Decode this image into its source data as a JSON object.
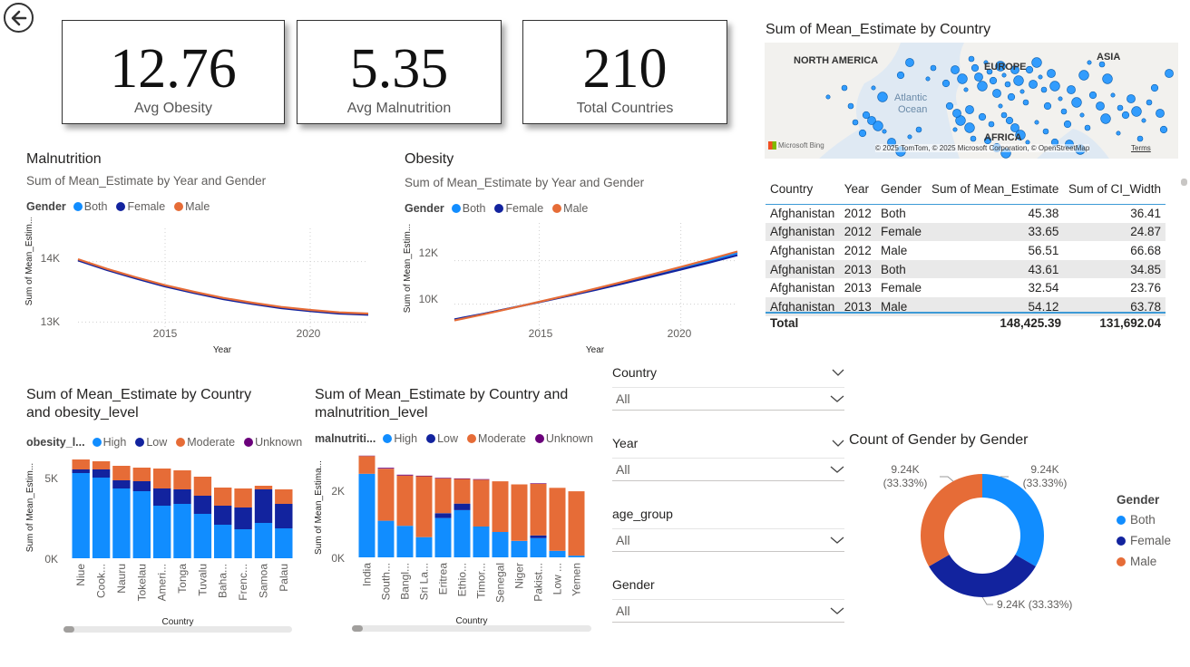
{
  "colors": {
    "both": "#118dff",
    "female": "#12239e",
    "male": "#e66c37",
    "unknown": "#6b007b",
    "high": "#118dff",
    "low": "#12239e",
    "moderate": "#e66c37"
  },
  "cards": [
    {
      "value": "12.76",
      "label": "Avg Obesity"
    },
    {
      "value": "5.35",
      "label": "Avg Malnutrition"
    },
    {
      "value": "210",
      "label": "Total Countries"
    }
  ],
  "map": {
    "title": "Sum of Mean_Estimate by Country",
    "labels": {
      "north_america": "NORTH AMERICA",
      "europe": "EUROPE",
      "asia": "ASIA",
      "atlantic": "Atlantic",
      "ocean": "Ocean",
      "africa": "AFRICA"
    },
    "bing": "Microsoft Bing",
    "copyright": "© 2025 TomTom, © 2025 Microsoft Corporation, © OpenStreetMap",
    "terms": "Terms"
  },
  "table": {
    "headers": [
      "Country",
      "Year",
      "Gender",
      "Sum of Mean_Estimate",
      "Sum of CI_Width"
    ],
    "rows": [
      [
        "Afghanistan",
        "2012",
        "Both",
        "45.38",
        "36.41"
      ],
      [
        "Afghanistan",
        "2012",
        "Female",
        "33.65",
        "24.87"
      ],
      [
        "Afghanistan",
        "2012",
        "Male",
        "56.51",
        "66.68"
      ],
      [
        "Afghanistan",
        "2013",
        "Both",
        "43.61",
        "34.85"
      ],
      [
        "Afghanistan",
        "2013",
        "Female",
        "32.54",
        "23.76"
      ],
      [
        "Afghanistan",
        "2013",
        "Male",
        "54.12",
        "63.78"
      ]
    ],
    "total": [
      "Total",
      "",
      "",
      "148,425.39",
      "131,692.04"
    ]
  },
  "malnutrition_line": {
    "title": "Malnutrition",
    "subtitle": "Sum of Mean_Estimate by Year and Gender",
    "legend_title": "Gender",
    "legend": [
      "Both",
      "Female",
      "Male"
    ],
    "ylabel": "Sum of Mean_Estim...",
    "xlabel": "Year",
    "yticks": [
      "14K",
      "13K"
    ],
    "xticks": [
      "2015",
      "2020"
    ]
  },
  "obesity_line": {
    "title": "Obesity",
    "subtitle": "Sum of Mean_Estimate by Year and Gender",
    "legend_title": "Gender",
    "legend": [
      "Both",
      "Female",
      "Male"
    ],
    "ylabel": "Sum of Mean_Estim...",
    "xlabel": "Year",
    "yticks": [
      "12K",
      "10K"
    ],
    "xticks": [
      "2015",
      "2020"
    ]
  },
  "obesity_bar": {
    "title": "Sum of Mean_Estimate by Country and obesity_level",
    "legend_title": "obesity_l...",
    "legend": [
      "High",
      "Low",
      "Moderate",
      "Unknown"
    ],
    "ylabel": "Sum of Mean_Estim...",
    "xlabel": "Country",
    "yticks": [
      "5K",
      "0K"
    ]
  },
  "malnutrition_bar": {
    "title": "Sum of Mean_Estimate by Country and malnutrition_level",
    "legend_title": "malnutriti...",
    "legend": [
      "High",
      "Low",
      "Moderate",
      "Unknown"
    ],
    "ylabel": "Sum of Mean_Estima...",
    "xlabel": "Country",
    "yticks": [
      "2K",
      "0K"
    ]
  },
  "slicers": [
    {
      "label": "Country",
      "value": "All"
    },
    {
      "label": "Year",
      "value": "All"
    },
    {
      "label": "age_group",
      "value": "All"
    },
    {
      "label": "Gender",
      "value": "All"
    }
  ],
  "donut": {
    "title": "Count of Gender by Gender",
    "legend_title": "Gender",
    "legend": [
      "Both",
      "Female",
      "Male"
    ],
    "label_both": "9.24K\n(33.33%)",
    "label_female": "9.24K (33.33%)",
    "label_male": "9.24K\n(33.33%)"
  },
  "chart_data": [
    {
      "type": "line",
      "title": "Malnutrition",
      "xlabel": "Year",
      "ylabel": "Sum of Mean_Estim...",
      "x": [
        2012,
        2013,
        2014,
        2015,
        2016,
        2017,
        2018,
        2019,
        2020,
        2021,
        2022
      ],
      "ylim": [
        12900,
        14250
      ],
      "series": [
        {
          "name": "Both",
          "values": [
            14030,
            13870,
            13730,
            13600,
            13490,
            13390,
            13310,
            13240,
            13190,
            13150,
            13130
          ]
        },
        {
          "name": "Female",
          "values": [
            14020,
            13860,
            13720,
            13590,
            13480,
            13380,
            13300,
            13230,
            13180,
            13140,
            13120
          ]
        },
        {
          "name": "Male",
          "values": [
            14040,
            13880,
            13740,
            13610,
            13500,
            13400,
            13320,
            13250,
            13200,
            13160,
            13140
          ]
        }
      ]
    },
    {
      "type": "line",
      "title": "Obesity",
      "xlabel": "Year",
      "ylabel": "Sum of Mean_Estim...",
      "x": [
        2012,
        2013,
        2014,
        2015,
        2016,
        2017,
        2018,
        2019,
        2020,
        2021,
        2022
      ],
      "ylim": [
        8900,
        12900
      ],
      "series": [
        {
          "name": "Both",
          "values": [
            9280,
            9540,
            9820,
            10100,
            10390,
            10690,
            11000,
            11320,
            11650,
            11990,
            12350
          ]
        },
        {
          "name": "Female",
          "values": [
            9300,
            9550,
            9820,
            10090,
            10370,
            10660,
            10960,
            11270,
            11590,
            11910,
            12250
          ]
        },
        {
          "name": "Male",
          "values": [
            9250,
            9520,
            9810,
            10110,
            10410,
            10720,
            11040,
            11370,
            11710,
            12060,
            12420
          ]
        }
      ]
    },
    {
      "type": "bar",
      "stacked": true,
      "title": "Sum of Mean_Estimate by Country and obesity_level",
      "xlabel": "Country",
      "ylabel": "Sum of Mean_Estim...",
      "categories": [
        "Niue",
        "Cook...",
        "Nauru",
        "Tokelau",
        "Ameri...",
        "Tonga",
        "Tuvalu",
        "Baha...",
        "Frenc...",
        "Samoa",
        "Palau"
      ],
      "ylim": [
        0,
        5800
      ],
      "series": [
        {
          "name": "High",
          "values": [
            4700,
            4450,
            3850,
            3700,
            2900,
            3000,
            2450,
            1850,
            1600,
            1950,
            1650
          ]
        },
        {
          "name": "Low",
          "values": [
            200,
            450,
            450,
            550,
            950,
            800,
            1000,
            1050,
            1200,
            1850,
            1350
          ]
        },
        {
          "name": "Moderate",
          "values": [
            550,
            450,
            800,
            750,
            1100,
            1050,
            1050,
            1000,
            1050,
            200,
            800
          ]
        },
        {
          "name": "Unknown",
          "values": [
            0,
            0,
            0,
            0,
            0,
            0,
            0,
            0,
            0,
            0,
            0
          ]
        }
      ]
    },
    {
      "type": "bar",
      "stacked": true,
      "title": "Sum of Mean_Estimate by Country and malnutrition_level",
      "xlabel": "Country",
      "ylabel": "Sum of Mean_Estima...",
      "categories": [
        "India",
        "South...",
        "Bangl...",
        "Sri La...",
        "Eritrea",
        "Ethio...",
        "Timor...",
        "Senegal",
        "Niger",
        "Pakist...",
        "Low ...",
        "Yemen"
      ],
      "ylim": [
        0,
        3150
      ],
      "series": [
        {
          "name": "High",
          "values": [
            2440,
            1070,
            920,
            590,
            1150,
            1380,
            900,
            740,
            480,
            560,
            190,
            50
          ]
        },
        {
          "name": "Low",
          "values": [
            0,
            0,
            0,
            0,
            140,
            190,
            0,
            0,
            0,
            80,
            0,
            0
          ]
        },
        {
          "name": "Moderate",
          "values": [
            520,
            1520,
            1470,
            1780,
            1020,
            720,
            1370,
            1480,
            1650,
            1510,
            1840,
            1880
          ]
        },
        {
          "name": "Unknown",
          "values": [
            10,
            25,
            25,
            15,
            15,
            15,
            15,
            0,
            0,
            15,
            0,
            0
          ]
        }
      ]
    },
    {
      "type": "pie",
      "donut": true,
      "title": "Count of Gender by Gender",
      "categories": [
        "Both",
        "Female",
        "Male"
      ],
      "values": [
        9240,
        9240,
        9240
      ]
    }
  ]
}
